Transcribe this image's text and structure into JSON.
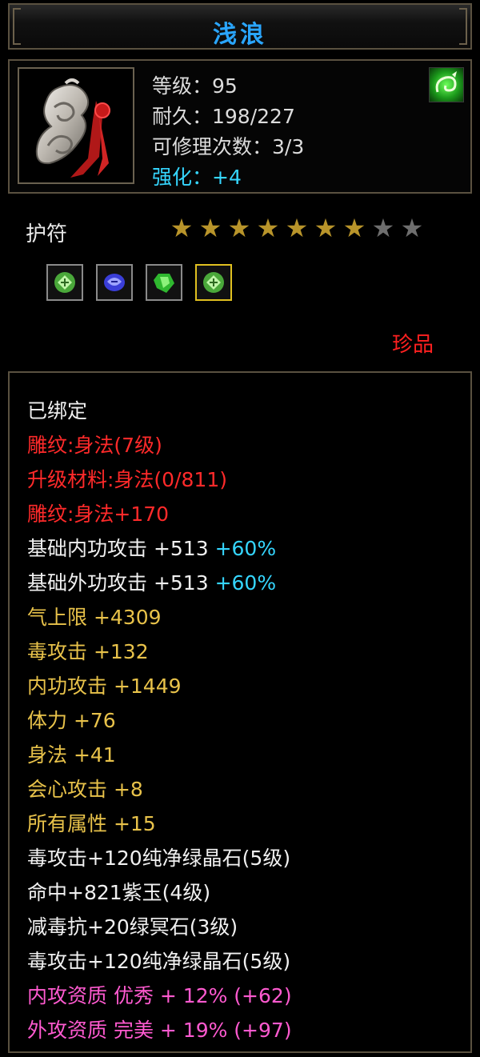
{
  "item": {
    "name": "浅浪",
    "level_line": "等级：95",
    "durability_line": "耐久：198/227",
    "repair_line": "可修理次数：3/3",
    "enhance_line": "强化：+4",
    "type": "护符",
    "stars_total": 9,
    "stars_filled": 7,
    "rarity": "珍品"
  },
  "gems": [
    {
      "icon": "green-crystal-icon",
      "color": "#7fe06a"
    },
    {
      "icon": "purple-jade-icon",
      "color": "#6a6cff"
    },
    {
      "icon": "green-stone-icon",
      "color": "#3cd03c"
    },
    {
      "icon": "green-crystal-icon",
      "color": "#7fe06a",
      "selected": true
    }
  ],
  "attributes": {
    "bound": "已绑定",
    "engrave1": "雕纹:身法(7级)",
    "upgrade_material": "升级材料:身法(0/811)",
    "engrave2": "雕纹:身法+170",
    "base_inner_label": "基础内功攻击 +513 ",
    "base_inner_pct": "+60%",
    "base_outer_label": "基础外功攻击 +513 ",
    "base_outer_pct": "+60%",
    "qi_limit": "气上限 +4309",
    "poison_attack": "毒攻击 +132",
    "inner_attack": "内功攻击 +1449",
    "stamina": "体力 +76",
    "agility": "身法 +41",
    "crit_attack": "会心攻击 +8",
    "all_attributes": "所有属性 +15",
    "gem1": "毒攻击+120纯净绿晶石(5级)",
    "gem2": "命中+821紫玉(4级)",
    "gem3": "减毒抗+20绿冥石(3级)",
    "gem4": "毒攻击+120纯净绿晶石(5级)",
    "inner_quality": "内攻资质 优秀 + 12% (+62)",
    "outer_quality": "外攻资质 完美 + 19% (+97)"
  },
  "colors": {
    "title": "#2aa6ff",
    "rarity": "#ff2020",
    "engrave": "#ff2a2a",
    "stat": "#e8c24a",
    "percent": "#35d6ff",
    "quality": "#ff5ad0"
  }
}
